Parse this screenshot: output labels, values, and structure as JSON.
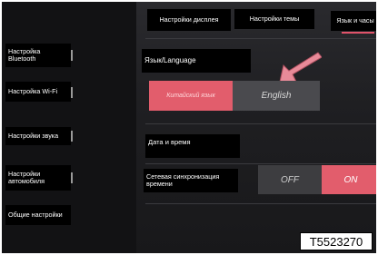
{
  "tabs": [
    {
      "label": "Настройки дисплея"
    },
    {
      "label": "Настройки темы"
    },
    {
      "label": "Язык и часы"
    }
  ],
  "sidebar": {
    "items": [
      {
        "label": "Настройка Bluetooth"
      },
      {
        "label": "Настройка Wi-Fi"
      },
      {
        "label": "Настройки звука"
      },
      {
        "label": "Настройки автомобиля"
      },
      {
        "label": "Общие настройки"
      }
    ]
  },
  "language": {
    "title": "Язык/Language",
    "options": [
      "Китайский язык",
      "English"
    ],
    "selected": "Китайский язык"
  },
  "datetime": {
    "title": "Дата и время"
  },
  "network_sync": {
    "label": "Сетевая синхронизация времени",
    "off_label": "OFF",
    "on_label": "ON",
    "value": "ON"
  },
  "figure_code": "T5523270",
  "colors": {
    "accent": "#e25d6c",
    "arrow": "#e88a98",
    "background": "#1a1a1c"
  }
}
